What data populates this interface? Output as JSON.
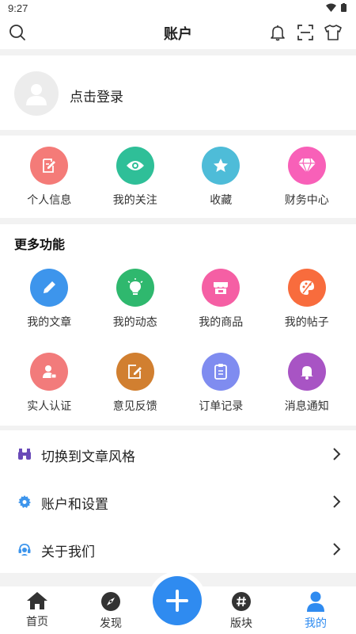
{
  "status": {
    "time": "9:27"
  },
  "header": {
    "title": "账户"
  },
  "login": {
    "text": "点击登录"
  },
  "quick": [
    {
      "label": "个人信息",
      "color": "#f47b78",
      "icon": "edit-document-icon"
    },
    {
      "label": "我的关注",
      "color": "#2fbf98",
      "icon": "eye-icon"
    },
    {
      "label": "收藏",
      "color": "#4ebcd8",
      "icon": "star-icon"
    },
    {
      "label": "财务中心",
      "color": "#f860b8",
      "icon": "diamond-icon"
    }
  ],
  "more": {
    "title": "更多功能",
    "items": [
      {
        "label": "我的文章",
        "color": "#3d95ec",
        "icon": "pencil-icon"
      },
      {
        "label": "我的动态",
        "color": "#2fb86e",
        "icon": "bulb-icon"
      },
      {
        "label": "我的商品",
        "color": "#f55fa4",
        "icon": "store-icon"
      },
      {
        "label": "我的帖子",
        "color": "#f86c3d",
        "icon": "palette-icon"
      },
      {
        "label": "实人认证",
        "color": "#f27b7b",
        "icon": "id-user-icon"
      },
      {
        "label": "意见反馈",
        "color": "#d17f30",
        "icon": "feedback-edit-icon"
      },
      {
        "label": "订单记录",
        "color": "#7f8cf0",
        "icon": "clipboard-icon"
      },
      {
        "label": "消息通知",
        "color": "#a854c4",
        "icon": "bell-icon"
      }
    ]
  },
  "menu": [
    {
      "label": "切换到文章风格",
      "icon": "binoculars-icon",
      "color": "#6a4ab8"
    },
    {
      "label": "账户和设置",
      "icon": "gear-icon",
      "color": "#3d95ec"
    },
    {
      "label": "关于我们",
      "icon": "headset-icon",
      "color": "#3d95ec"
    }
  ],
  "tabs": [
    {
      "label": "首页",
      "icon": "home-icon"
    },
    {
      "label": "发现",
      "icon": "compass-icon"
    },
    {
      "label": "版块",
      "icon": "hash-icon"
    },
    {
      "label": "我的",
      "icon": "user-icon",
      "active": true
    }
  ],
  "accent": "#2f8bf0"
}
